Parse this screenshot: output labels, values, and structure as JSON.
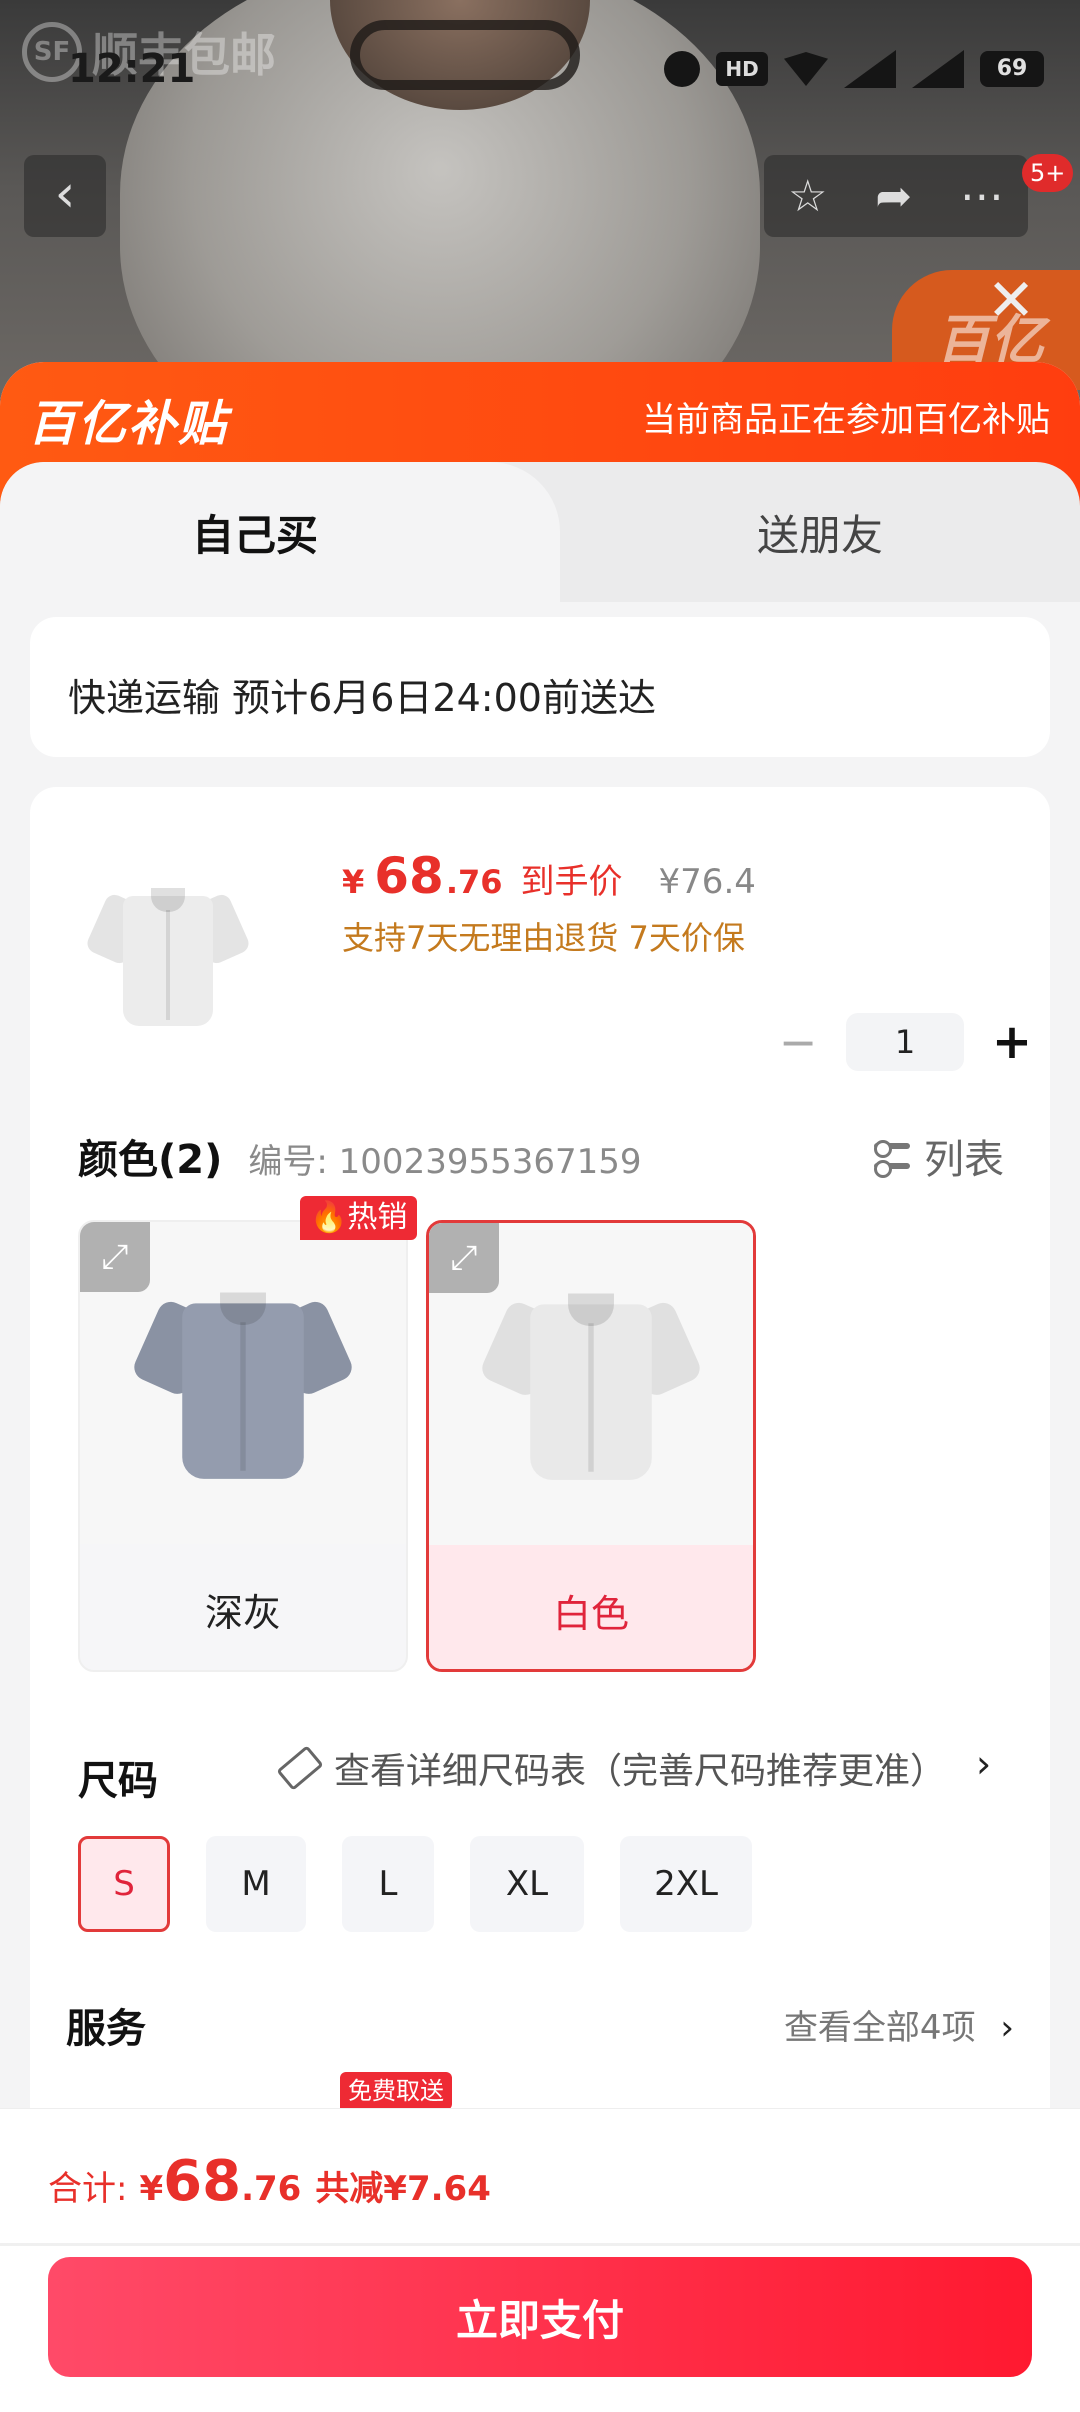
{
  "background": {
    "watermark_logo": "SF",
    "watermark_text": "顺丰包邮",
    "float_badge": "百亿"
  },
  "status_bar": {
    "time": "12:21",
    "hd_label": "HD",
    "battery": "69"
  },
  "nav": {
    "back_glyph": "‹",
    "badge": "5+"
  },
  "banner": {
    "logo": "百亿补贴",
    "text": "当前商品正在参加百亿补贴"
  },
  "tabs": {
    "buy_self": "自己买",
    "gift_friend": "送朋友"
  },
  "delivery": {
    "text": "快递运输 预计6月6日24:00前送达"
  },
  "product": {
    "price_symbol": "¥",
    "price_int": "68",
    "price_dec": ".76",
    "price_label": "到手价",
    "original_price": "¥76.4",
    "promise": "支持7天无理由退货 7天价保",
    "quantity": "1",
    "minus": "−",
    "plus": "+"
  },
  "color": {
    "title": "颜色(2)",
    "code": "编号: 10023955367159",
    "list_label": "列表",
    "hot_tag": "🔥热销",
    "options": [
      {
        "label": "深灰",
        "shirt_color": "#8f97a8",
        "selected": false
      },
      {
        "label": "白色",
        "shirt_color": "#e6e6e6",
        "selected": true
      }
    ]
  },
  "size": {
    "title": "尺码",
    "guide": "查看详细尺码表（完善尺码推荐更准）",
    "chevron": "›",
    "options": [
      "S",
      "M",
      "L",
      "XL",
      "2XL"
    ],
    "selected": "S"
  },
  "service": {
    "title": "服务",
    "more": "查看全部4项",
    "chevron": "›",
    "tag": "免费取送"
  },
  "footer": {
    "total_label": "合计:",
    "total_symbol": "¥",
    "total_int": "68",
    "total_dec": ".76",
    "saving": "共减¥7.64",
    "pay_button": "立即支付"
  },
  "colors": {
    "accent_red": "#e8302a",
    "banner_orange": "#ff5a12",
    "pay_gradient_start": "#ff4a68",
    "pay_gradient_end": "#ff1930",
    "promise_gold": "#c47a1e"
  }
}
